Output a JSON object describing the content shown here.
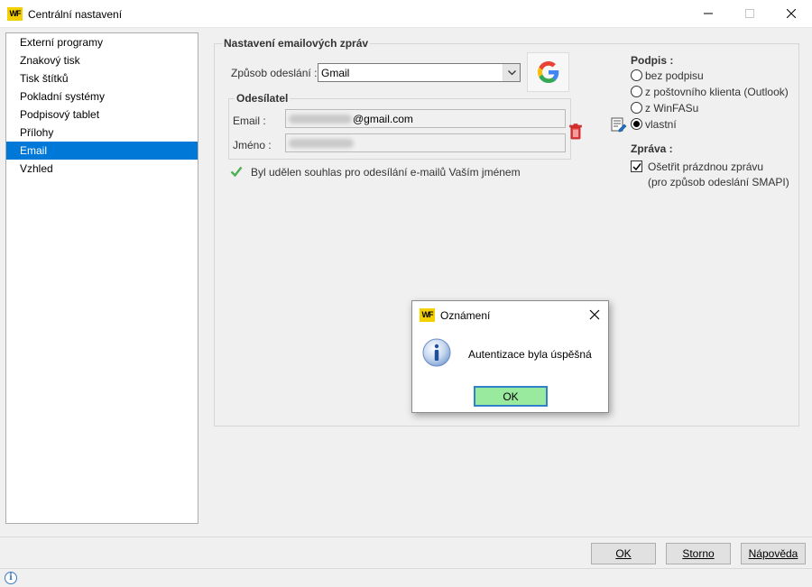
{
  "window": {
    "title": "Centrální nastavení",
    "logo": "WF"
  },
  "sidebar": {
    "items": [
      {
        "label": "Externí programy"
      },
      {
        "label": "Znakový tisk"
      },
      {
        "label": "Tisk štítků"
      },
      {
        "label": "Pokladní systémy"
      },
      {
        "label": "Podpisový tablet"
      },
      {
        "label": "Přílohy"
      },
      {
        "label": "Email",
        "selected": true
      },
      {
        "label": "Vzhled"
      }
    ]
  },
  "email_settings": {
    "title": "Nastavení emailových zpráv",
    "method_label": "Způsob odeslání :",
    "method_value": "Gmail",
    "sender": {
      "title": "Odesílatel",
      "email_label": "Email :",
      "email_suffix": "@gmail.com",
      "name_label": "Jméno :"
    },
    "consent_text": "Byl udělen souhlas pro odesílání e-mailů Vaším jménem"
  },
  "signature": {
    "title": "Podpis :",
    "options": [
      {
        "label": "bez podpisu",
        "checked": false
      },
      {
        "label": "z poštovního klienta (Outlook)",
        "checked": false
      },
      {
        "label": "z WinFASu",
        "checked": false
      },
      {
        "label": "vlastní",
        "checked": true
      }
    ]
  },
  "message": {
    "title": "Zpráva :",
    "empty_check_label": "Ošetřit prázdnou zprávu",
    "empty_check_note": "(pro způsob odeslání SMAPI)",
    "empty_check_checked": true
  },
  "footer": {
    "ok": "OK",
    "cancel": "Storno",
    "help": "Nápověda"
  },
  "dialog": {
    "logo": "WF",
    "title": "Oznámení",
    "message": "Autentizace byla úspěšná",
    "ok": "OK"
  },
  "colors": {
    "selection": "#0078d7",
    "logo_yellow": "#f5d000",
    "ok_button": "#99e99e",
    "focus_border": "#2f82c9",
    "consent_check": "#4caf50"
  },
  "icons": {
    "google": "google-icon",
    "trash": "trash-icon",
    "edit": "edit-signature-icon",
    "info": "info-icon",
    "check": "check-icon"
  }
}
